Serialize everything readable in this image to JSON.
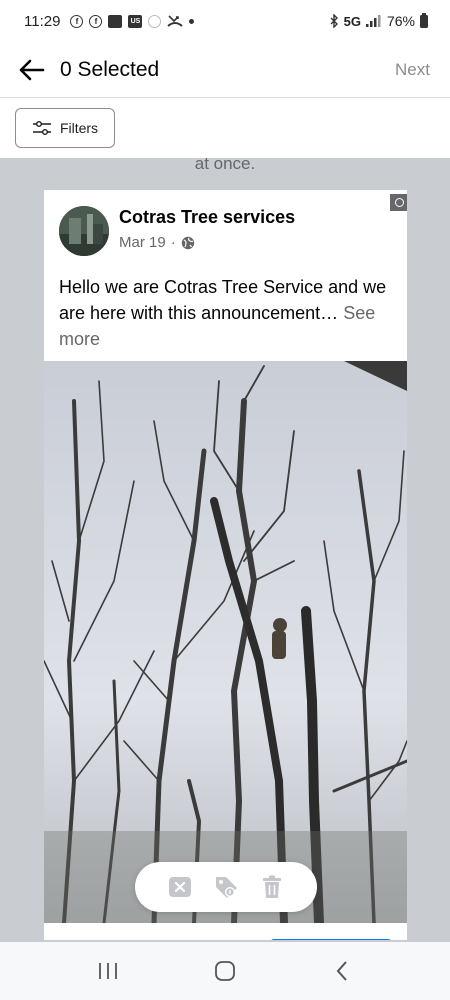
{
  "status_bar": {
    "time": "11:29",
    "notif_icons": [
      "facebook-icon",
      "facebook-icon",
      "news-icon",
      "us-app-icon",
      "data-saver-icon",
      "missed-call-icon"
    ],
    "us_label": "US",
    "network": "5G",
    "battery": "76%"
  },
  "header": {
    "title": "0 Selected",
    "next_label": "Next"
  },
  "filters": {
    "label": "Filters"
  },
  "feed": {
    "previous_post_tail": "at once."
  },
  "post": {
    "page_name": "Cotras Tree services",
    "date": "Mar 19",
    "separator": "·",
    "text": "Hello we are Cotras Tree Service and we are here with this announcement…",
    "see_more": "See more",
    "photo_subject": "worker-climbing-bare-tree-in-snow",
    "selected": false
  },
  "actions": {
    "icons": [
      "remove-icon",
      "tag-icon",
      "trash-icon"
    ]
  },
  "nav": {
    "icons": [
      "recents-icon",
      "home-icon",
      "back-icon"
    ]
  },
  "colors": {
    "accent": "#1877f2",
    "background": "#c9ccd1",
    "muted_text": "#65676b"
  }
}
